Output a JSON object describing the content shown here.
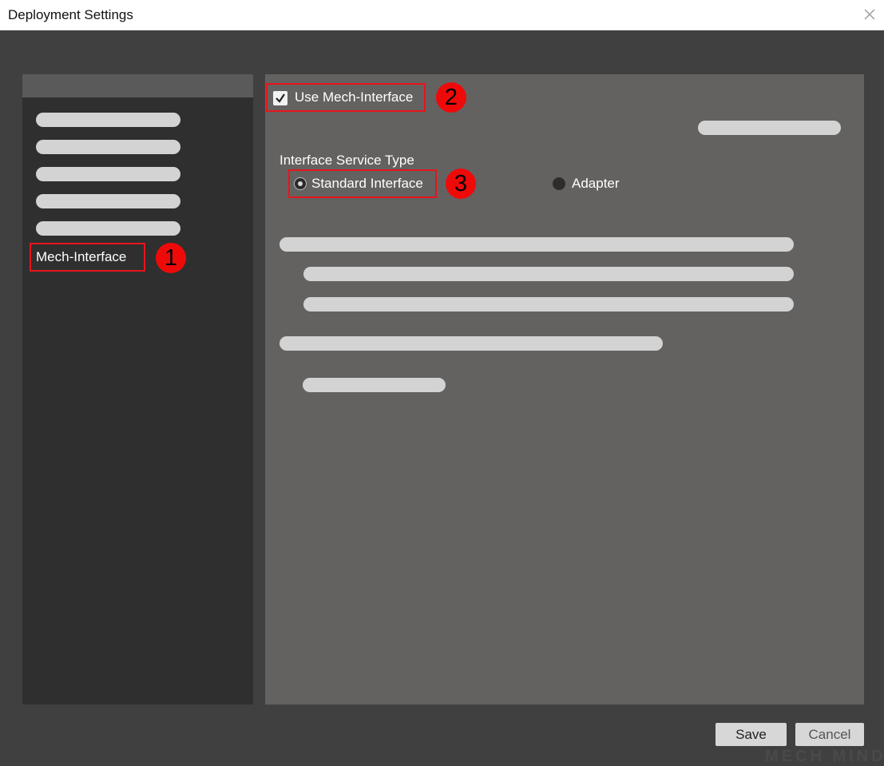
{
  "window": {
    "title": "Deployment Settings",
    "close_icon": "close-icon"
  },
  "sidebar": {
    "selected_item": "Mech-Interface"
  },
  "main": {
    "use_checkbox": {
      "label": "Use Mech-Interface",
      "checked": true
    },
    "service_type": {
      "label": "Interface Service Type",
      "options": [
        "Standard Interface",
        "Adapter"
      ],
      "selected": "Standard Interface"
    }
  },
  "annotations": [
    "1",
    "2",
    "3"
  ],
  "buttons": {
    "save": "Save",
    "cancel": "Cancel"
  },
  "watermark": "MECH MIND",
  "colors": {
    "highlight_border": "#e8141b",
    "badge": "#ef0a0a",
    "sidebar_bg": "#2f2f2f",
    "main_bg": "#636261"
  }
}
